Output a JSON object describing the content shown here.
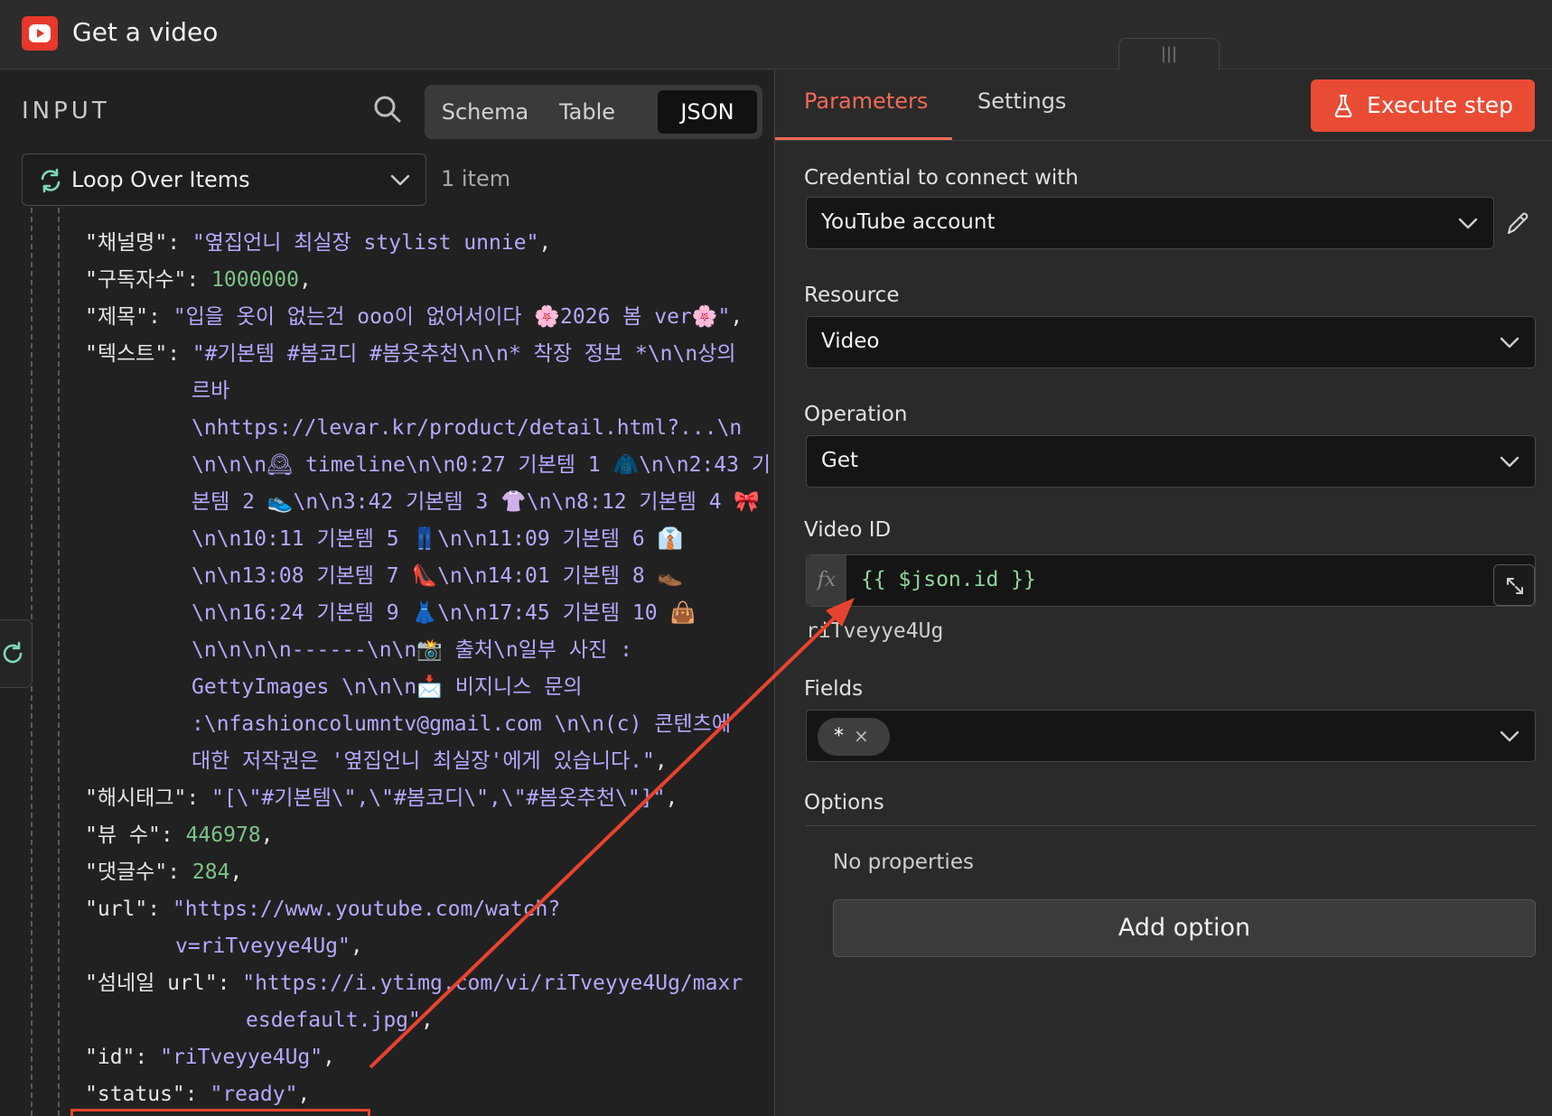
{
  "header": {
    "title": "Get a video",
    "drag_glyph": "|||"
  },
  "input_panel": {
    "label": "INPUT",
    "view_tabs": [
      "Schema",
      "Table",
      "JSON"
    ],
    "active_view": "JSON",
    "source_node": "Loop Over Items",
    "item_count": "1 item",
    "json_lines": [
      {
        "indent": 0,
        "key": "\"채널명\"",
        "sep": ": ",
        "value": "\"옆집언니 최실장 stylist unnie\"",
        "type": "s",
        "tail": ","
      },
      {
        "indent": 0,
        "key": "\"구독자수\"",
        "sep": ": ",
        "value": "1000000",
        "type": "n",
        "tail": ","
      },
      {
        "indent": 0,
        "key": "\"제목\"",
        "sep": ": ",
        "value": "\"입을 옷이 없는건 ooo이 없어서이다 🌸2026 봄 ver🌸\"",
        "type": "s",
        "tail": ","
      },
      {
        "indent": 0,
        "key": "\"텍스트\"",
        "sep": ": ",
        "value": "\"#기본템 #봄코디 #봄옷추천\\n\\n*  착장 정보 *\\n\\n상의",
        "type": "s",
        "tail": ""
      },
      {
        "indent": 1,
        "key": "",
        "sep": "",
        "value": "르바",
        "type": "s",
        "tail": ""
      },
      {
        "indent": 1,
        "key": "",
        "sep": "",
        "value": "\\nhttps://levar.kr/product/detail.html?...\\n",
        "type": "s",
        "tail": ""
      },
      {
        "indent": 1,
        "key": "",
        "sep": "",
        "value": "\\n\\n\\n🕰 timeline\\n\\n0:27 기본템 1 🧥\\n\\n2:43 기",
        "type": "s",
        "tail": ""
      },
      {
        "indent": 1,
        "key": "",
        "sep": "",
        "value": "본템 2 👟\\n\\n3:42 기본템 3 👚\\n\\n8:12 기본템 4 🎀",
        "type": "s",
        "tail": ""
      },
      {
        "indent": 1,
        "key": "",
        "sep": "",
        "value": "\\n\\n10:11 기본템 5 👖\\n\\n11:09 기본템 6 👔",
        "type": "s",
        "tail": ""
      },
      {
        "indent": 1,
        "key": "",
        "sep": "",
        "value": "\\n\\n13:08 기본템 7 👠\\n\\n14:01 기본템 8 👞",
        "type": "s",
        "tail": ""
      },
      {
        "indent": 1,
        "key": "",
        "sep": "",
        "value": "\\n\\n16:24 기본템 9 👗\\n\\n17:45 기본템 10 👜",
        "type": "s",
        "tail": ""
      },
      {
        "indent": 1,
        "key": "",
        "sep": "",
        "value": "\\n\\n\\n\\n------\\n\\n📸 출처\\n일부 사진 :",
        "type": "s",
        "tail": ""
      },
      {
        "indent": 1,
        "key": "",
        "sep": "",
        "value": "GettyImages \\n\\n\\n📩 비지니스 문의",
        "type": "s",
        "tail": ""
      },
      {
        "indent": 1,
        "key": "",
        "sep": "",
        "value": ":\\nfashioncolumntv@gmail.com \\n\\n(c) 콘텐츠에",
        "type": "s",
        "tail": ""
      },
      {
        "indent": 1,
        "key": "",
        "sep": "",
        "value": "대한 저작권은 '옆집언니 최실장'에게 있습니다.\"",
        "type": "s",
        "tail": ","
      },
      {
        "indent": 0,
        "key": "\"해시태그\"",
        "sep": ": ",
        "value": "\"[\\\"#기본템\\\",\\\"#봄코디\\\",\\\"#봄옷추천\\\"]\"",
        "type": "s",
        "tail": ","
      },
      {
        "indent": 0,
        "key": "\"뷰 수\"",
        "sep": ": ",
        "value": "446978",
        "type": "n",
        "tail": ","
      },
      {
        "indent": 0,
        "key": "\"댓글수\"",
        "sep": ": ",
        "value": "284",
        "type": "n",
        "tail": ","
      },
      {
        "indent": 0,
        "key": "\"url\"",
        "sep": ": ",
        "value": "\"https://www.youtube.com/watch?",
        "type": "s",
        "tail": ""
      },
      {
        "indent": 2,
        "key": "",
        "sep": "",
        "value": "v=riTveyye4Ug\"",
        "type": "s",
        "tail": ","
      },
      {
        "indent": 0,
        "key": "\"섬네일 url\"",
        "sep": ": ",
        "value": "\"https://i.ytimg.com/vi/riTveyye4Ug/maxr",
        "type": "s",
        "tail": ""
      },
      {
        "indent": 3,
        "key": "",
        "sep": "",
        "value": "esdefault.jpg\"",
        "type": "s",
        "tail": ","
      },
      {
        "indent": 0,
        "key": "\"id\"",
        "sep": ": ",
        "value": "\"riTveyye4Ug\"",
        "type": "s",
        "tail": ","
      },
      {
        "indent": 0,
        "key": "\"status\"",
        "sep": ": ",
        "value": "\"ready\"",
        "type": "s",
        "tail": ","
      }
    ]
  },
  "params_panel": {
    "tabs": [
      "Parameters",
      "Settings"
    ],
    "active_tab": "Parameters",
    "execute_label": "Execute step",
    "credential_label": "Credential to connect with",
    "credential_value": "YouTube account",
    "resource_label": "Resource",
    "resource_value": "Video",
    "operation_label": "Operation",
    "operation_value": "Get",
    "video_id_label": "Video ID",
    "fx_label": "fx",
    "video_id_expression": "{{ $json.id }}",
    "video_id_result": "riTveyye4Ug",
    "fields_label": "Fields",
    "fields_chip": "*",
    "chip_remove": "×",
    "options_label": "Options",
    "no_properties": "No properties",
    "add_option_label": "Add option"
  },
  "colors": {
    "accent": "#ea4b34",
    "string": "#b7a8ff",
    "number": "#7ec387",
    "expression": "#8fd79c"
  }
}
